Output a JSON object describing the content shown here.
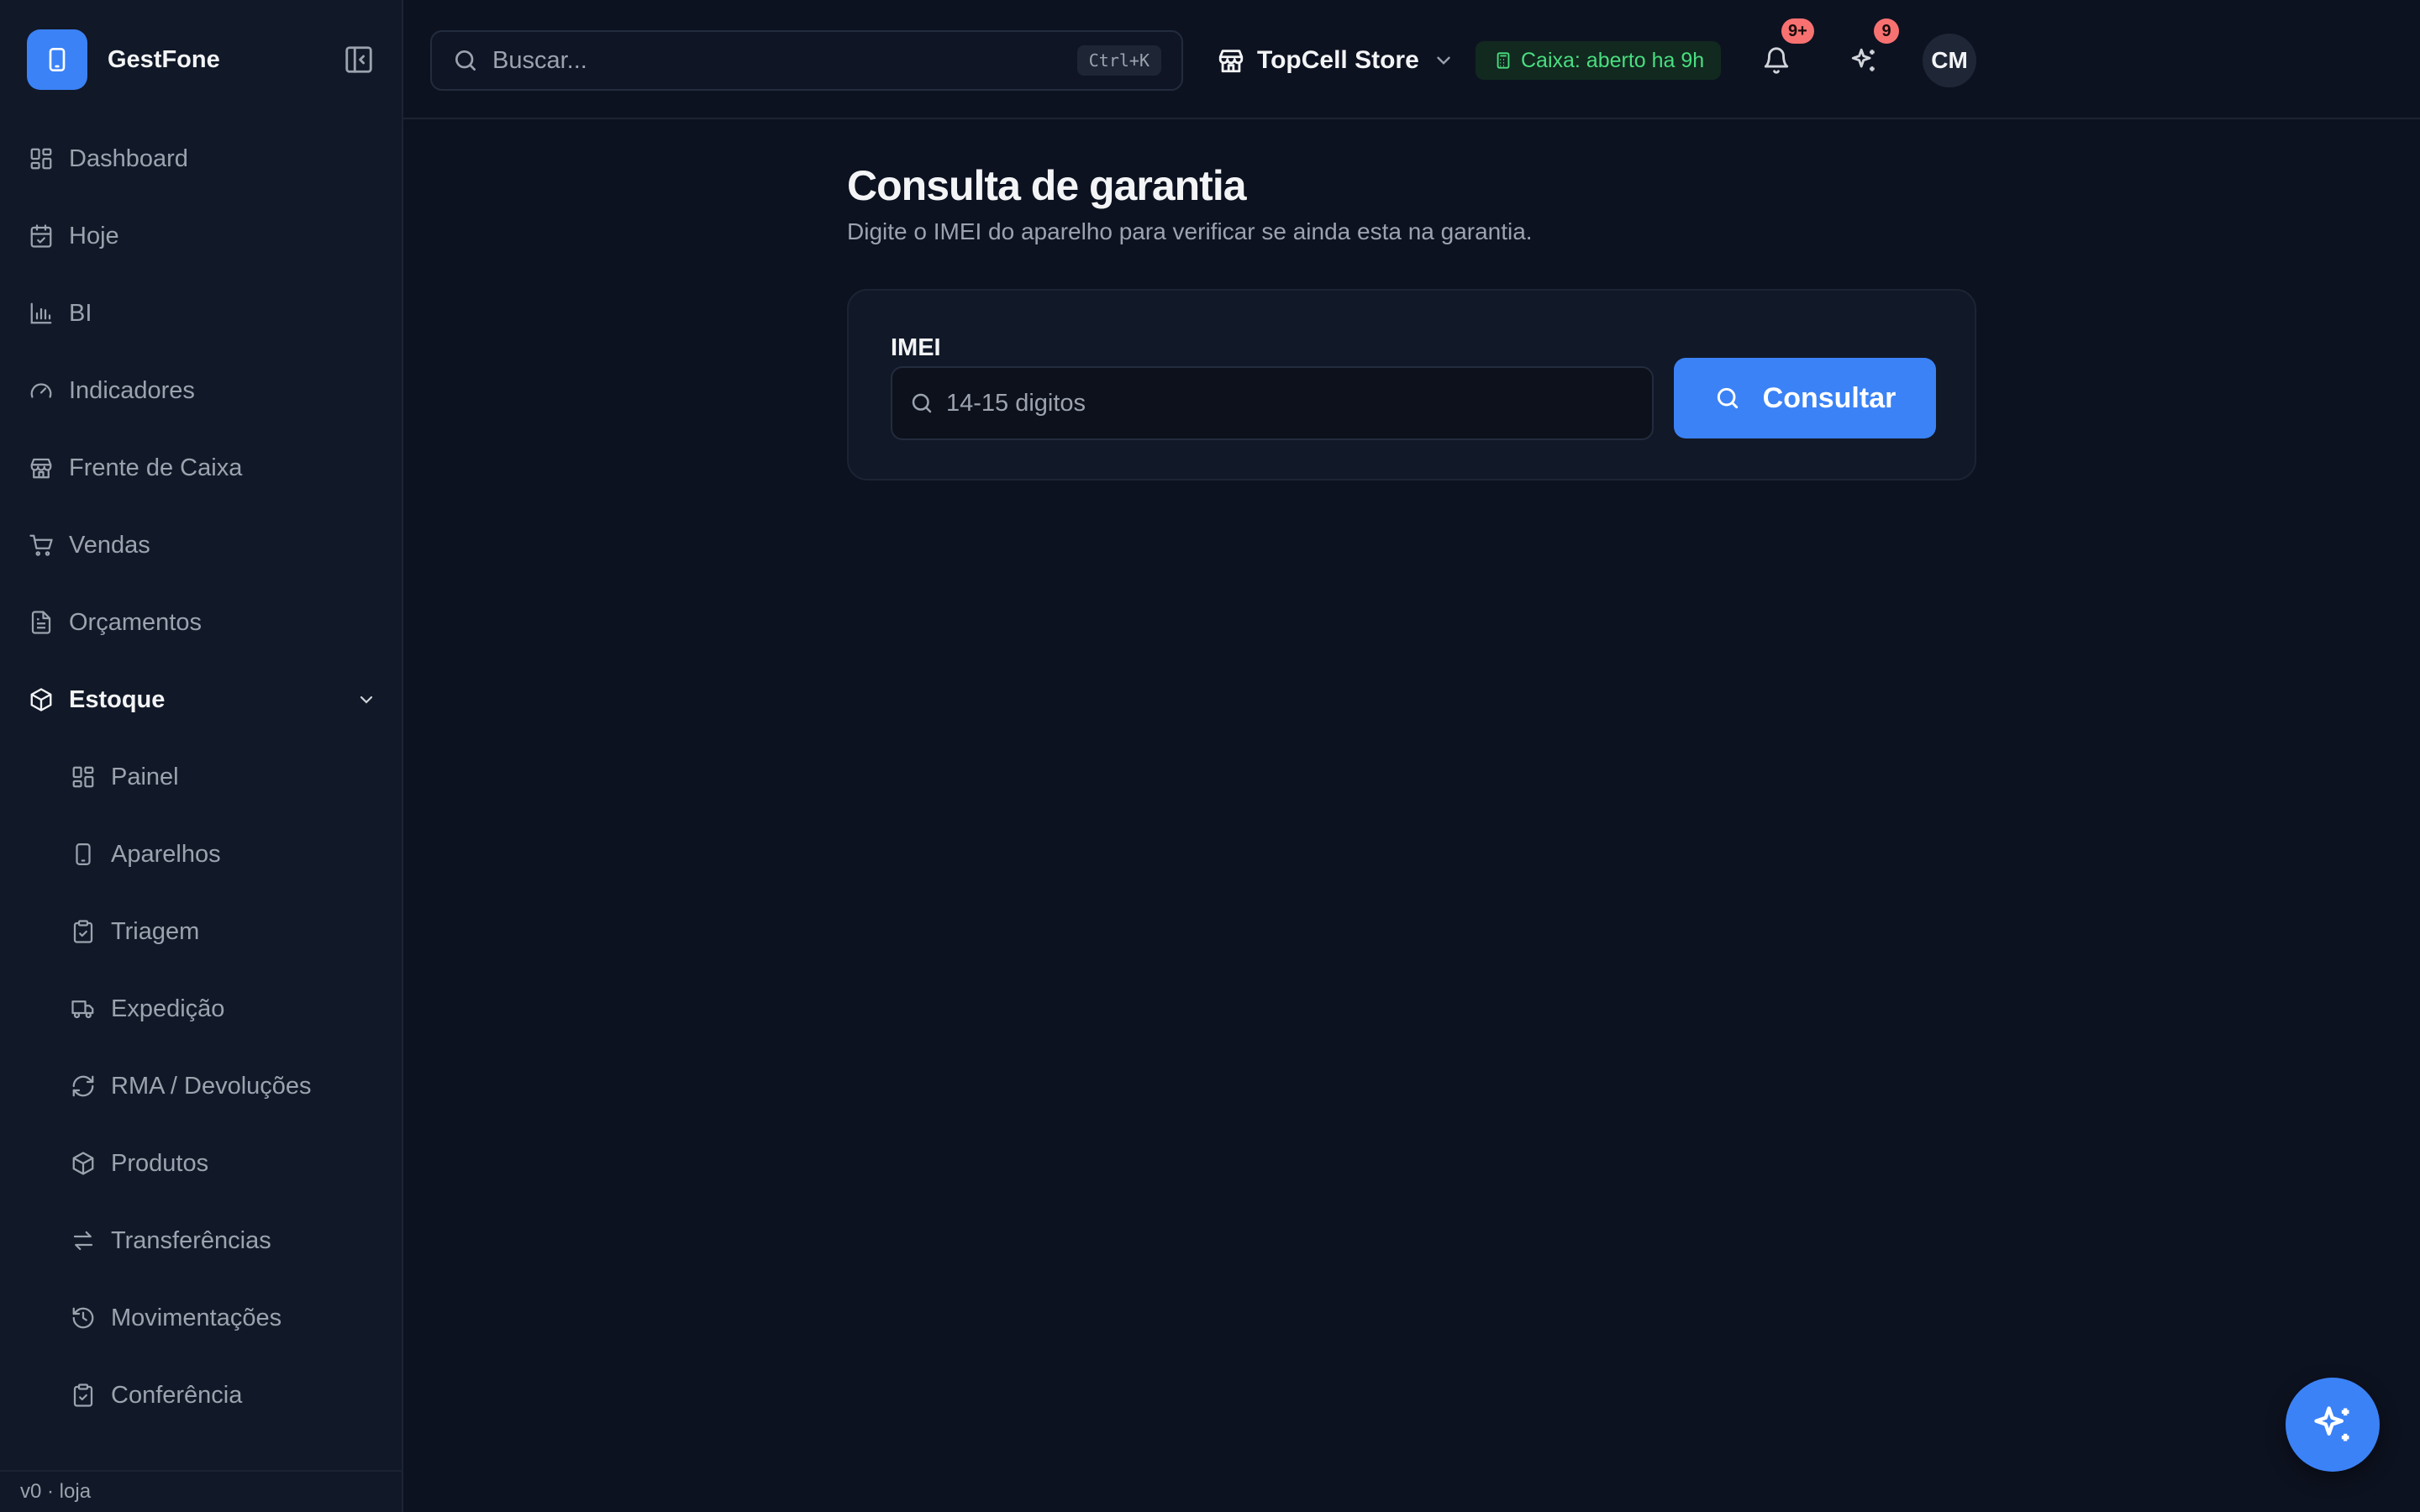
{
  "app": {
    "brand_name": "GestFone",
    "version": "v0 · loja"
  },
  "colors": {
    "accent": "#3b82f6",
    "background": "#0d1220",
    "sidebar": "#111827",
    "success": "#4ade80",
    "danger_badge": "#f87171"
  },
  "sidebar": {
    "items": [
      {
        "label": "Dashboard",
        "icon": "dashboard-icon"
      },
      {
        "label": "Hoje",
        "icon": "calendar-check-icon"
      },
      {
        "label": "BI",
        "icon": "bar-chart-icon"
      },
      {
        "label": "Indicadores",
        "icon": "gauge-icon"
      },
      {
        "label": "Frente de Caixa",
        "icon": "store-icon"
      },
      {
        "label": "Vendas",
        "icon": "cart-icon"
      },
      {
        "label": "Orçamentos",
        "icon": "document-icon"
      }
    ],
    "group": {
      "label": "Estoque",
      "icon": "package-icon",
      "expanded": true,
      "children": [
        {
          "label": "Painel",
          "icon": "dashboard-icon"
        },
        {
          "label": "Aparelhos",
          "icon": "smartphone-icon"
        },
        {
          "label": "Triagem",
          "icon": "clipboard-check-icon"
        },
        {
          "label": "Expedição",
          "icon": "truck-icon"
        },
        {
          "label": "RMA / Devoluções",
          "icon": "refresh-icon"
        },
        {
          "label": "Produtos",
          "icon": "package-icon"
        },
        {
          "label": "Transferências",
          "icon": "arrows-swap-icon"
        },
        {
          "label": "Movimentações",
          "icon": "history-icon"
        },
        {
          "label": "Conferência",
          "icon": "clipboard-check-icon"
        }
      ]
    }
  },
  "header": {
    "search_placeholder": "Buscar...",
    "search_shortcut": "Ctrl+K",
    "store_name": "TopCell Store",
    "caixa_status": "Caixa: aberto ha 9h",
    "notifications_count": "9+",
    "ai_count": "9",
    "avatar_initials": "CM"
  },
  "main": {
    "title": "Consulta de garantia",
    "subtitle": "Digite o IMEI do aparelho para verificar se ainda esta na garantia.",
    "field_label": "IMEI",
    "imei_placeholder": "14-15 digitos",
    "imei_value": "",
    "submit_label": "Consultar"
  }
}
